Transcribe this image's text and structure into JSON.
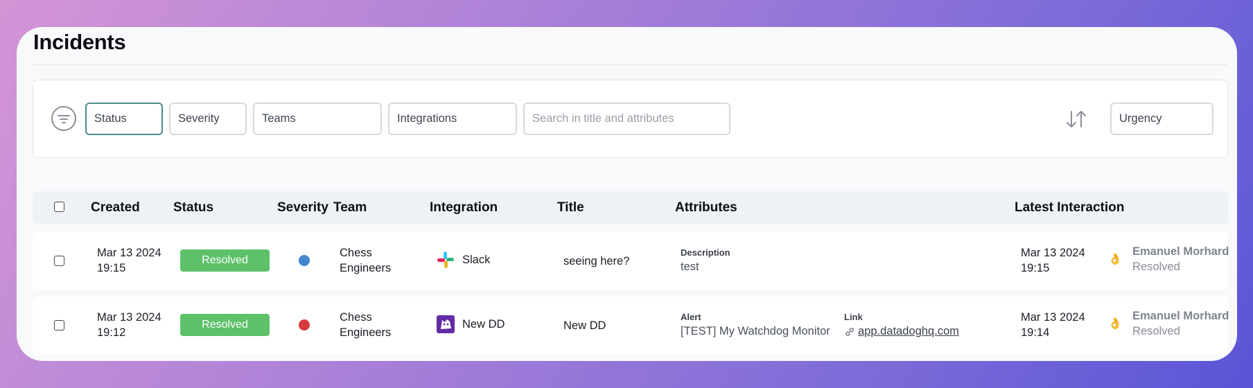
{
  "page": {
    "title": "Incidents"
  },
  "filters": {
    "status": "Status",
    "severity": "Severity",
    "teams": "Teams",
    "integrations": "Integrations",
    "search_placeholder": "Search in title and attributes",
    "sort": "Urgency"
  },
  "table": {
    "columns": [
      "Created",
      "Status",
      "Severity",
      "Team",
      "Integration",
      "Title",
      "Attributes",
      "Latest Interaction"
    ],
    "rows": [
      {
        "created_date": "Mar 13 2024",
        "created_time": "19:15",
        "status": "Resolved",
        "severity_color": "#3f86cf",
        "team_line1": "Chess",
        "team_line2": "Engineers",
        "integration": "Slack",
        "integration_icon": "slack-icon",
        "title": "seeing here?",
        "attr1_label": "Description",
        "attr1_value": "test",
        "latest_date": "Mar 13 2024",
        "latest_time": "19:15",
        "user": "Emanuel Morhard",
        "action": "Resolved"
      },
      {
        "created_date": "Mar 13 2024",
        "created_time": "19:12",
        "status": "Resolved",
        "severity_color": "#d63b3b",
        "team_line1": "Chess",
        "team_line2": "Engineers",
        "integration": "New DD",
        "integration_icon": "datadog-icon",
        "title": "New DD",
        "attr1_label": "Alert",
        "attr1_value": "[TEST] My Watchdog Monitor",
        "attr2_label": "Link",
        "attr2_value": "app.datadoghq.com",
        "latest_date": "Mar 13 2024",
        "latest_time": "19:14",
        "user": "Emanuel Morhard",
        "action": "Resolved"
      }
    ]
  },
  "colors": {
    "resolved": "#5ec16a",
    "active_border": "#4a8c86",
    "hand_icon": "#e9b23a"
  }
}
